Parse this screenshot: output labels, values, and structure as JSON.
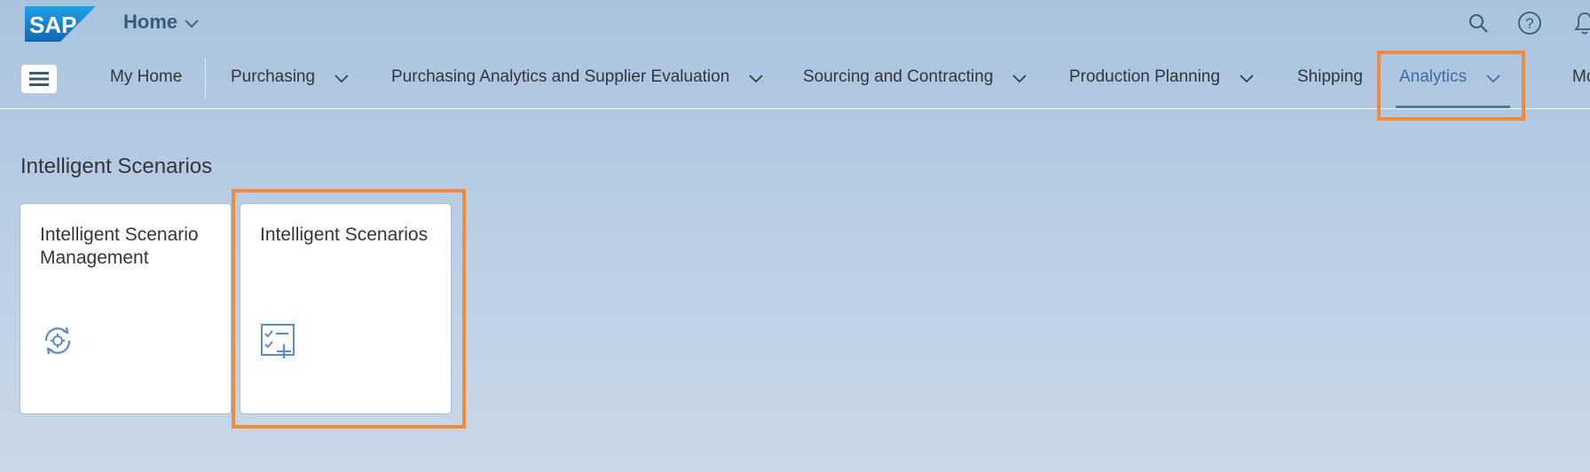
{
  "shell": {
    "logo_text": "SAP",
    "title": "Home",
    "icons": [
      "search-icon",
      "help-icon",
      "notification-bell-icon"
    ]
  },
  "nav": {
    "menu_icon": "hamburger-menu-icon",
    "items": [
      {
        "label": "My Home",
        "has_dropdown": false
      },
      {
        "label": "Purchasing",
        "has_dropdown": true
      },
      {
        "label": "Purchasing Analytics and Supplier Evaluation",
        "has_dropdown": true
      },
      {
        "label": "Sourcing and Contracting",
        "has_dropdown": true
      },
      {
        "label": "Production Planning",
        "has_dropdown": true
      },
      {
        "label": "Shipping",
        "has_dropdown": false
      },
      {
        "label": "Analytics",
        "has_dropdown": true,
        "active": true
      },
      {
        "label": "Mo",
        "has_dropdown": false
      }
    ]
  },
  "section": {
    "title": "Intelligent Scenarios",
    "tiles": [
      {
        "title": "Intelligent Scenario Management",
        "icon": "gear-sync-icon"
      },
      {
        "title": "Intelligent Scenarios",
        "icon": "checklist-add-icon"
      }
    ]
  },
  "colors": {
    "highlight": "#f08a3c",
    "brand_blue": "#1a73c9",
    "active_nav": "#3c6da0"
  }
}
